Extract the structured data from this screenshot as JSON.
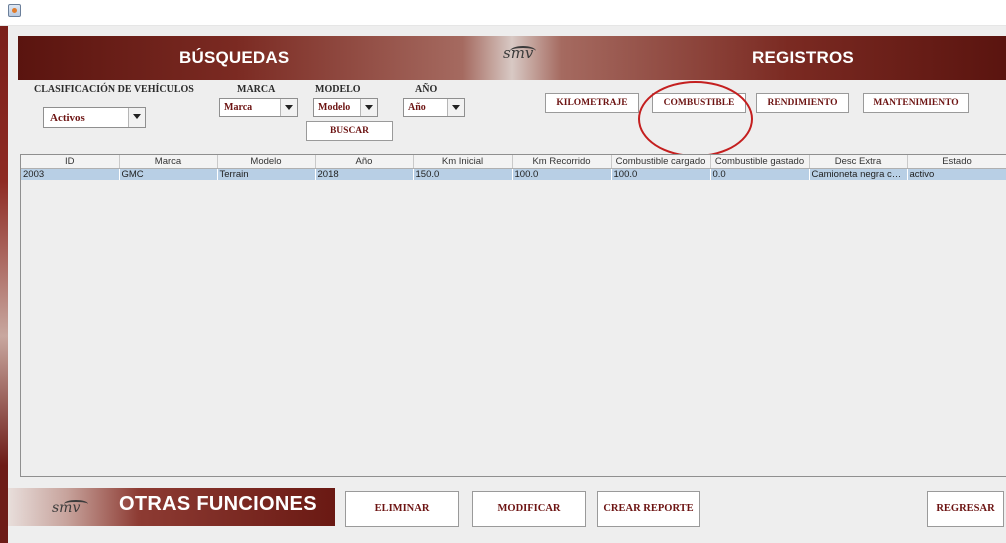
{
  "header": {
    "left_title": "BÚSQUEDAS",
    "right_title": "REGISTROS",
    "logo_text": "smv"
  },
  "filters": {
    "clasificacion_label": "CLASIFICACIÓN DE VEHÍCULOS",
    "clasificacion_value": "Activos",
    "marca_label": "MARCA",
    "marca_value": "Marca",
    "modelo_label": "MODELO",
    "modelo_value": "Modelo",
    "anio_label": "AÑO",
    "anio_value": "Año",
    "buscar_label": "BUSCAR"
  },
  "registros": {
    "kilometraje": "KILOMETRAJE",
    "combustible": "COMBUSTIBLE",
    "rendimiento": "RENDIMIENTO",
    "mantenimiento": "MANTENIMIENTO"
  },
  "table": {
    "columns": [
      "ID",
      "Marca",
      "Modelo",
      "Año",
      "Km Inicial",
      "Km Recorrido",
      "Combustible cargado",
      "Combustible gastado",
      "Desc Extra",
      "Estado"
    ],
    "rows": [
      [
        "2003",
        "GMC",
        "Terrain",
        "2018",
        "150.0",
        "100.0",
        "100.0",
        "0.0",
        "Camioneta negra con...",
        "activo"
      ]
    ]
  },
  "footer": {
    "otras_funciones": "OTRAS  FUNCIONES",
    "logo_text": "smv",
    "eliminar": "ELIMINAR",
    "modificar": "MODIFICAR",
    "crear_reporte": "CREAR REPORTE",
    "regresar": "REGRESAR"
  },
  "colors": {
    "accent_dark_red": "#6d1413",
    "selection_blue": "#b8cfe5",
    "highlight_red": "#c41f1f"
  }
}
